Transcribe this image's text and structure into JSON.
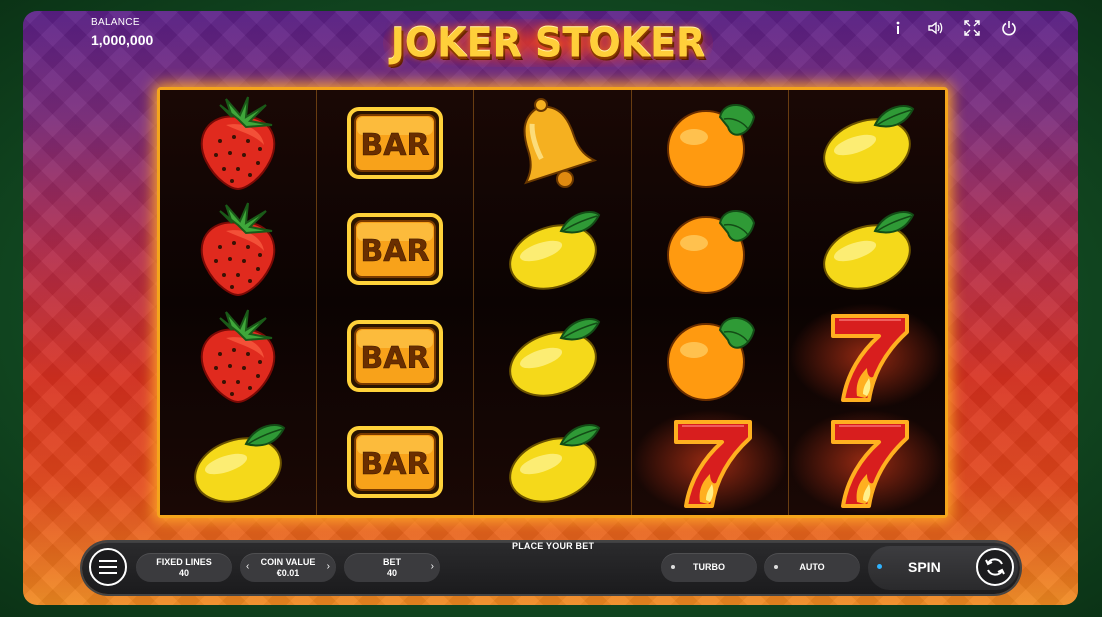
{
  "balance": {
    "label": "BALANCE",
    "value": "1,000,000"
  },
  "logo": {
    "text": "JOKER STOKER"
  },
  "top_icons": [
    "info-icon",
    "sound-icon",
    "fullscreen-icon",
    "power-icon"
  ],
  "reels": [
    [
      "strawberry",
      "strawberry",
      "strawberry",
      "lemon"
    ],
    [
      "bar",
      "bar",
      "bar",
      "bar"
    ],
    [
      "bell",
      "lemon",
      "lemon",
      "lemon"
    ],
    [
      "orange",
      "orange",
      "orange",
      "seven"
    ],
    [
      "lemon",
      "lemon",
      "seven",
      "seven"
    ]
  ],
  "bar_symbol_text": "BAR",
  "panel": {
    "place_bet": "PLACE YOUR BET",
    "fixed_lines": {
      "label": "FIXED LINES",
      "value": "40"
    },
    "coin_value": {
      "label": "COIN VALUE",
      "value": "€0.01"
    },
    "bet": {
      "label": "BET",
      "value": "40"
    },
    "turbo": "TURBO",
    "auto": "AUTO",
    "spin": "SPIN"
  },
  "colors": {
    "accent": "#f5a51c",
    "spin_dot": "#2fb3ff"
  }
}
